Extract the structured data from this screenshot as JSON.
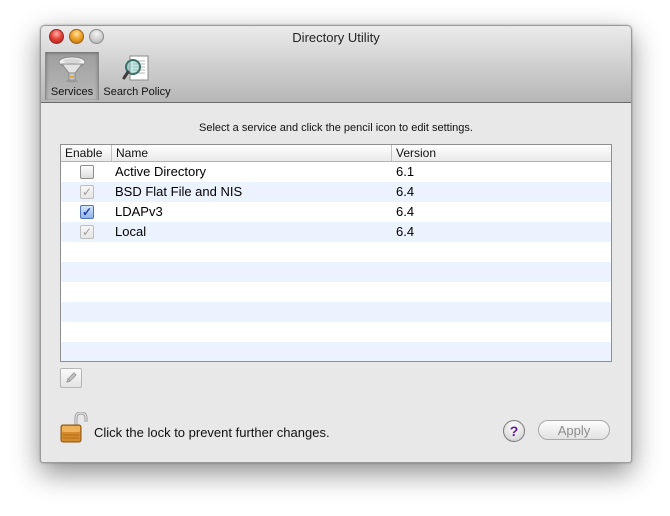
{
  "window": {
    "title": "Directory Utility"
  },
  "toolbar": {
    "items": [
      {
        "label": "Services",
        "icon": "services-icon",
        "selected": true
      },
      {
        "label": "Search Policy",
        "icon": "search-policy-icon",
        "selected": false
      }
    ]
  },
  "main": {
    "instruction": "Select a service and click the pencil icon to edit settings.",
    "table": {
      "columns": [
        "Enable",
        "Name",
        "Version"
      ],
      "rows": [
        {
          "enabled": false,
          "locked": false,
          "name": "Active Directory",
          "version": "6.1"
        },
        {
          "enabled": true,
          "locked": true,
          "name": "BSD Flat File and NIS",
          "version": "6.4"
        },
        {
          "enabled": true,
          "locked": false,
          "name": "LDAPv3",
          "version": "6.4"
        },
        {
          "enabled": true,
          "locked": true,
          "name": "Local",
          "version": "6.4"
        }
      ]
    },
    "edit_button_icon": "pencil-icon"
  },
  "footer": {
    "lock_icon": "lock-icon",
    "lock_text": "Click the lock to prevent further changes.",
    "help_label": "?",
    "apply_label": "Apply"
  },
  "colors": {
    "row_alt": "#edf3fe",
    "check_active": "#1d3d99",
    "help_glyph": "#5a1a9a"
  }
}
